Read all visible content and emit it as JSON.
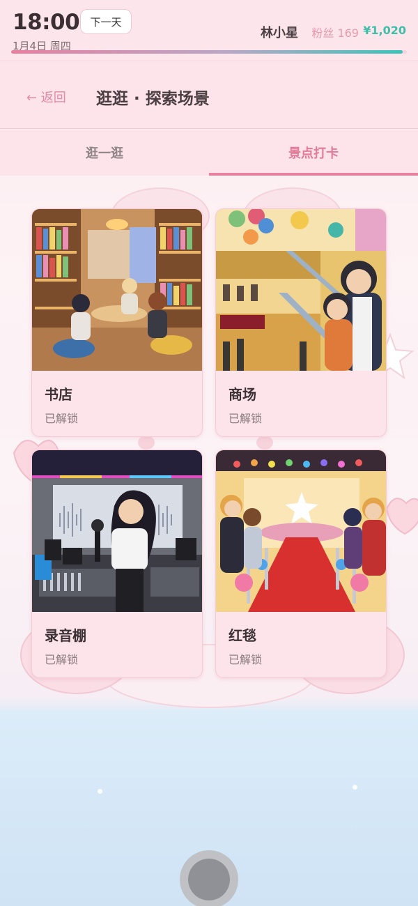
{
  "status": {
    "time": "18:00",
    "next_day_label": "下一天",
    "date": "1月4日 周四",
    "player_name": "林小星",
    "fans": "粉丝 169",
    "money": "¥1,020",
    "day_progress": 0.99
  },
  "header": {
    "back_label": "← 返回",
    "title": "逛逛 · 探索场景"
  },
  "tabs": [
    {
      "label": "逛一逛",
      "active": false
    },
    {
      "label": "景点打卡",
      "active": true
    }
  ],
  "scenes": [
    {
      "name": "书店",
      "status": "已解锁",
      "image": "bookstore-illustration"
    },
    {
      "name": "商场",
      "status": "已解锁",
      "image": "mall-illustration"
    },
    {
      "name": "录音棚",
      "status": "已解锁",
      "image": "recording-studio-illustration"
    },
    {
      "name": "红毯",
      "status": "已解锁",
      "image": "red-carpet-illustration"
    }
  ],
  "colors": {
    "accent_pink": "#e8819f",
    "money_teal": "#3fbfa8",
    "card_bg": "#fde3ea"
  }
}
